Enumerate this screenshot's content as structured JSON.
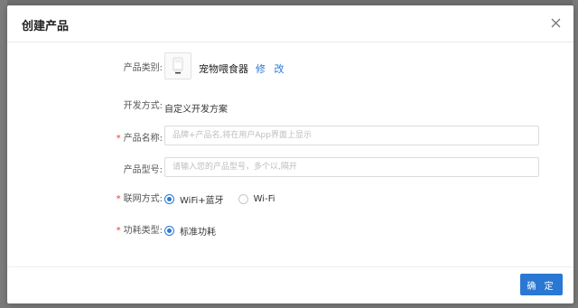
{
  "dialog": {
    "title": "创建产品"
  },
  "form": {
    "category": {
      "label": "产品类别:",
      "product_name": "宠物喂食器",
      "edit_label": "修 改"
    },
    "dev_method": {
      "label": "开发方式:",
      "value": "自定义开发方案"
    },
    "product_name": {
      "required_mark": "*",
      "label": "产品名称:",
      "placeholder": "品牌+产品名,将在用户App界面上显示",
      "value": ""
    },
    "product_model": {
      "label": "产品型号:",
      "placeholder": "请输入您的产品型号，多个以,隔开",
      "value": ""
    },
    "network": {
      "required_mark": "*",
      "label": "联网方式:",
      "options": [
        "WiFi+蓝牙",
        "Wi-Fi"
      ],
      "selected": "WiFi+蓝牙"
    },
    "power": {
      "required_mark": "*",
      "label": "功耗类型:",
      "options": [
        "标准功耗"
      ],
      "selected": "标准功耗"
    }
  },
  "footer": {
    "confirm_label": "确 定"
  },
  "colors": {
    "accent": "#2a78d4",
    "required": "#e04040",
    "overlay": "#6f6f6f"
  },
  "icons": {
    "close": "close-icon",
    "product": "pet-feeder-icon"
  }
}
